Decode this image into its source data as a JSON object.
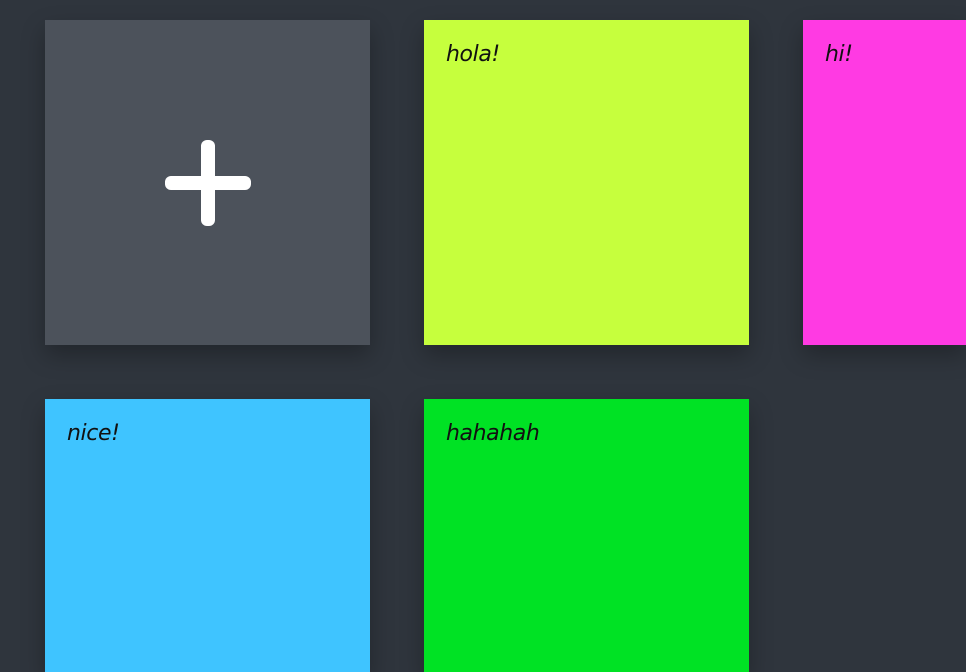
{
  "board": {
    "add_tile": {
      "icon": "plus-icon"
    },
    "notes": [
      {
        "text": "hola!",
        "color": "#c6ff3d"
      },
      {
        "text": "hi!",
        "color": "#ff3ae3"
      },
      {
        "text": "nice!",
        "color": "#3fc4ff"
      },
      {
        "text": "hahahah",
        "color": "#00e224"
      }
    ]
  },
  "colors": {
    "background": "#2f353d",
    "add_tile_background": "#4c525b",
    "text": "#111111"
  }
}
